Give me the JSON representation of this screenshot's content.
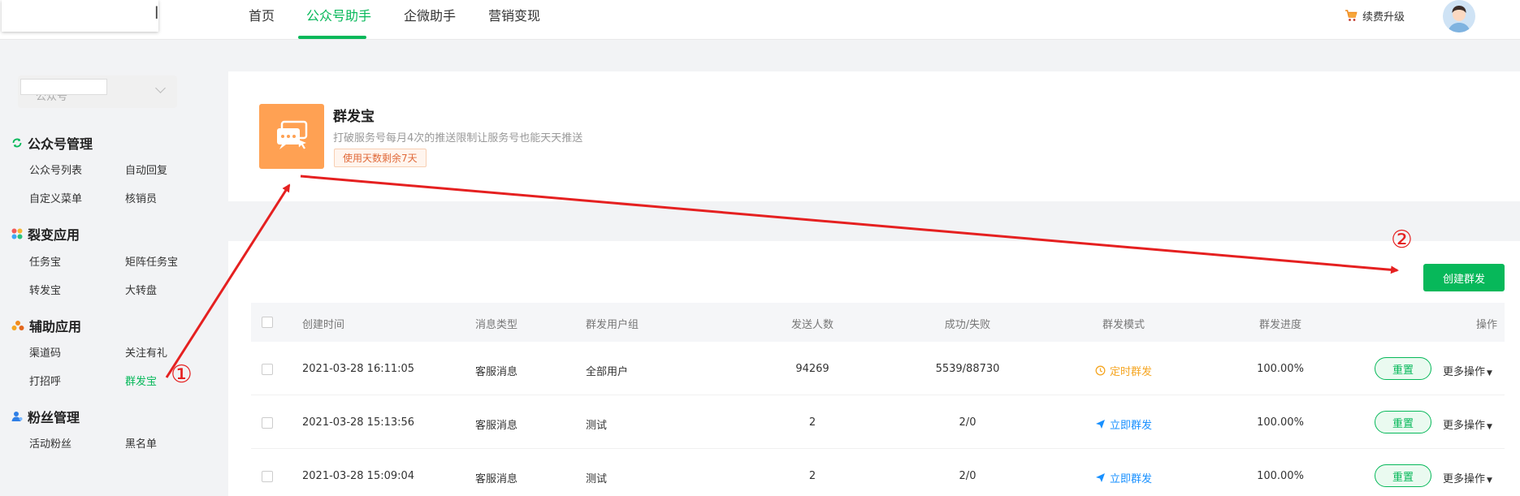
{
  "topnav": {
    "logo_glyph": "l",
    "items": [
      {
        "label": "首页",
        "active": false
      },
      {
        "label": "公众号助手",
        "active": true
      },
      {
        "label": "企微助手",
        "active": false
      },
      {
        "label": "营销变现",
        "active": false
      }
    ],
    "renew_label": "续费升级"
  },
  "sidebar": {
    "account_text": "公众号",
    "sections": [
      {
        "title": "公众号管理",
        "icon": "refresh-icon",
        "items": [
          "公众号列表",
          "自动回复",
          "自定义菜单",
          "核销员"
        ]
      },
      {
        "title": "裂变应用",
        "icon": "apps-icon",
        "items": [
          "任务宝",
          "矩阵任务宝",
          "转发宝",
          "大转盘"
        ]
      },
      {
        "title": "辅助应用",
        "icon": "group-icon",
        "items": [
          "渠道码",
          "关注有礼",
          "打招呼",
          "群发宝"
        ]
      },
      {
        "title": "粉丝管理",
        "icon": "user-icon",
        "items": [
          "活动粉丝",
          "黑名单"
        ]
      }
    ],
    "active_item": "群发宝"
  },
  "card": {
    "title": "群发宝",
    "description": "打破服务号每月4次的推送限制让服务号也能天天推送",
    "badge": "使用天数剩余7天"
  },
  "toolbar": {
    "create_label": "创建群发"
  },
  "table": {
    "headers": [
      "创建时间",
      "消息类型",
      "群发用户组",
      "发送人数",
      "成功/失败",
      "群发模式",
      "群发进度",
      "操作"
    ],
    "rows": [
      {
        "time": "2021-03-28 16:11:05",
        "msg_type": "客服消息",
        "group": "全部用户",
        "count": "94269",
        "result": "5539/88730",
        "mode": "定时群发",
        "mode_kind": "timed",
        "progress": "100.00%"
      },
      {
        "time": "2021-03-28 15:13:56",
        "msg_type": "客服消息",
        "group": "测试",
        "count": "2",
        "result": "2/0",
        "mode": "立即群发",
        "mode_kind": "now",
        "progress": "100.00%"
      },
      {
        "time": "2021-03-28 15:09:04",
        "msg_type": "客服消息",
        "group": "测试",
        "count": "2",
        "result": "2/0",
        "mode": "立即群发",
        "mode_kind": "now",
        "progress": "100.00%"
      }
    ],
    "reset_label": "重置",
    "more_label": "更多操作"
  },
  "annotations": {
    "step1": "①",
    "step2": "②"
  },
  "colors": {
    "brand_green": "#07b85a",
    "timed_orange": "#f5a623",
    "now_blue": "#1890ff",
    "annotation_red": "#e52020",
    "card_icon_orange": "#ffa153"
  }
}
